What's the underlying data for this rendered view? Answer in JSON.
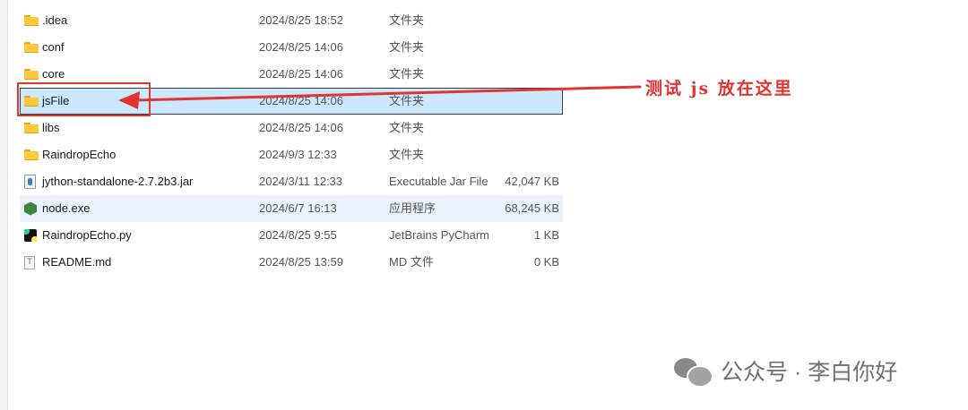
{
  "files": [
    {
      "name": ".idea",
      "date": "2024/8/25 18:52",
      "type": "文件夹",
      "size": "",
      "icon": "folder-icon"
    },
    {
      "name": "conf",
      "date": "2024/8/25 14:06",
      "type": "文件夹",
      "size": "",
      "icon": "folder-icon"
    },
    {
      "name": "core",
      "date": "2024/8/25 14:06",
      "type": "文件夹",
      "size": "",
      "icon": "folder-icon"
    },
    {
      "name": "jsFile",
      "date": "2024/8/25 14:06",
      "type": "文件夹",
      "size": "",
      "icon": "folder-icon",
      "state": "selected"
    },
    {
      "name": "libs",
      "date": "2024/8/25 14:06",
      "type": "文件夹",
      "size": "",
      "icon": "folder-icon"
    },
    {
      "name": "RaindropEcho",
      "date": "2024/9/3 12:33",
      "type": "文件夹",
      "size": "",
      "icon": "folder-icon"
    },
    {
      "name": "jython-standalone-2.7.2b3.jar",
      "date": "2024/3/11 12:33",
      "type": "Executable Jar File",
      "size": "42,047 KB",
      "icon": "java-jar-icon"
    },
    {
      "name": "node.exe",
      "date": "2024/6/7 16:13",
      "type": "应用程序",
      "size": "68,245 KB",
      "icon": "nodejs-icon",
      "state": "hover"
    },
    {
      "name": "RaindropEcho.py",
      "date": "2024/8/25 9:55",
      "type": "JetBrains PyCharm",
      "size": "1 KB",
      "icon": "pycharm-icon"
    },
    {
      "name": "README.md",
      "date": "2024/8/25 13:59",
      "type": "MD 文件",
      "size": "0 KB",
      "icon": "text-file-icon"
    }
  ],
  "annotation": {
    "text": "测试 js 放在这里",
    "color": "#e23430"
  },
  "watermark": {
    "text": "公众号 · 李白你好",
    "icon": "wechat-icon"
  },
  "colors": {
    "selected_bg": "#cce8ff",
    "hover_bg": "#eaf3fd",
    "folder": "#ffc83d",
    "annotation_red": "#e23430"
  }
}
